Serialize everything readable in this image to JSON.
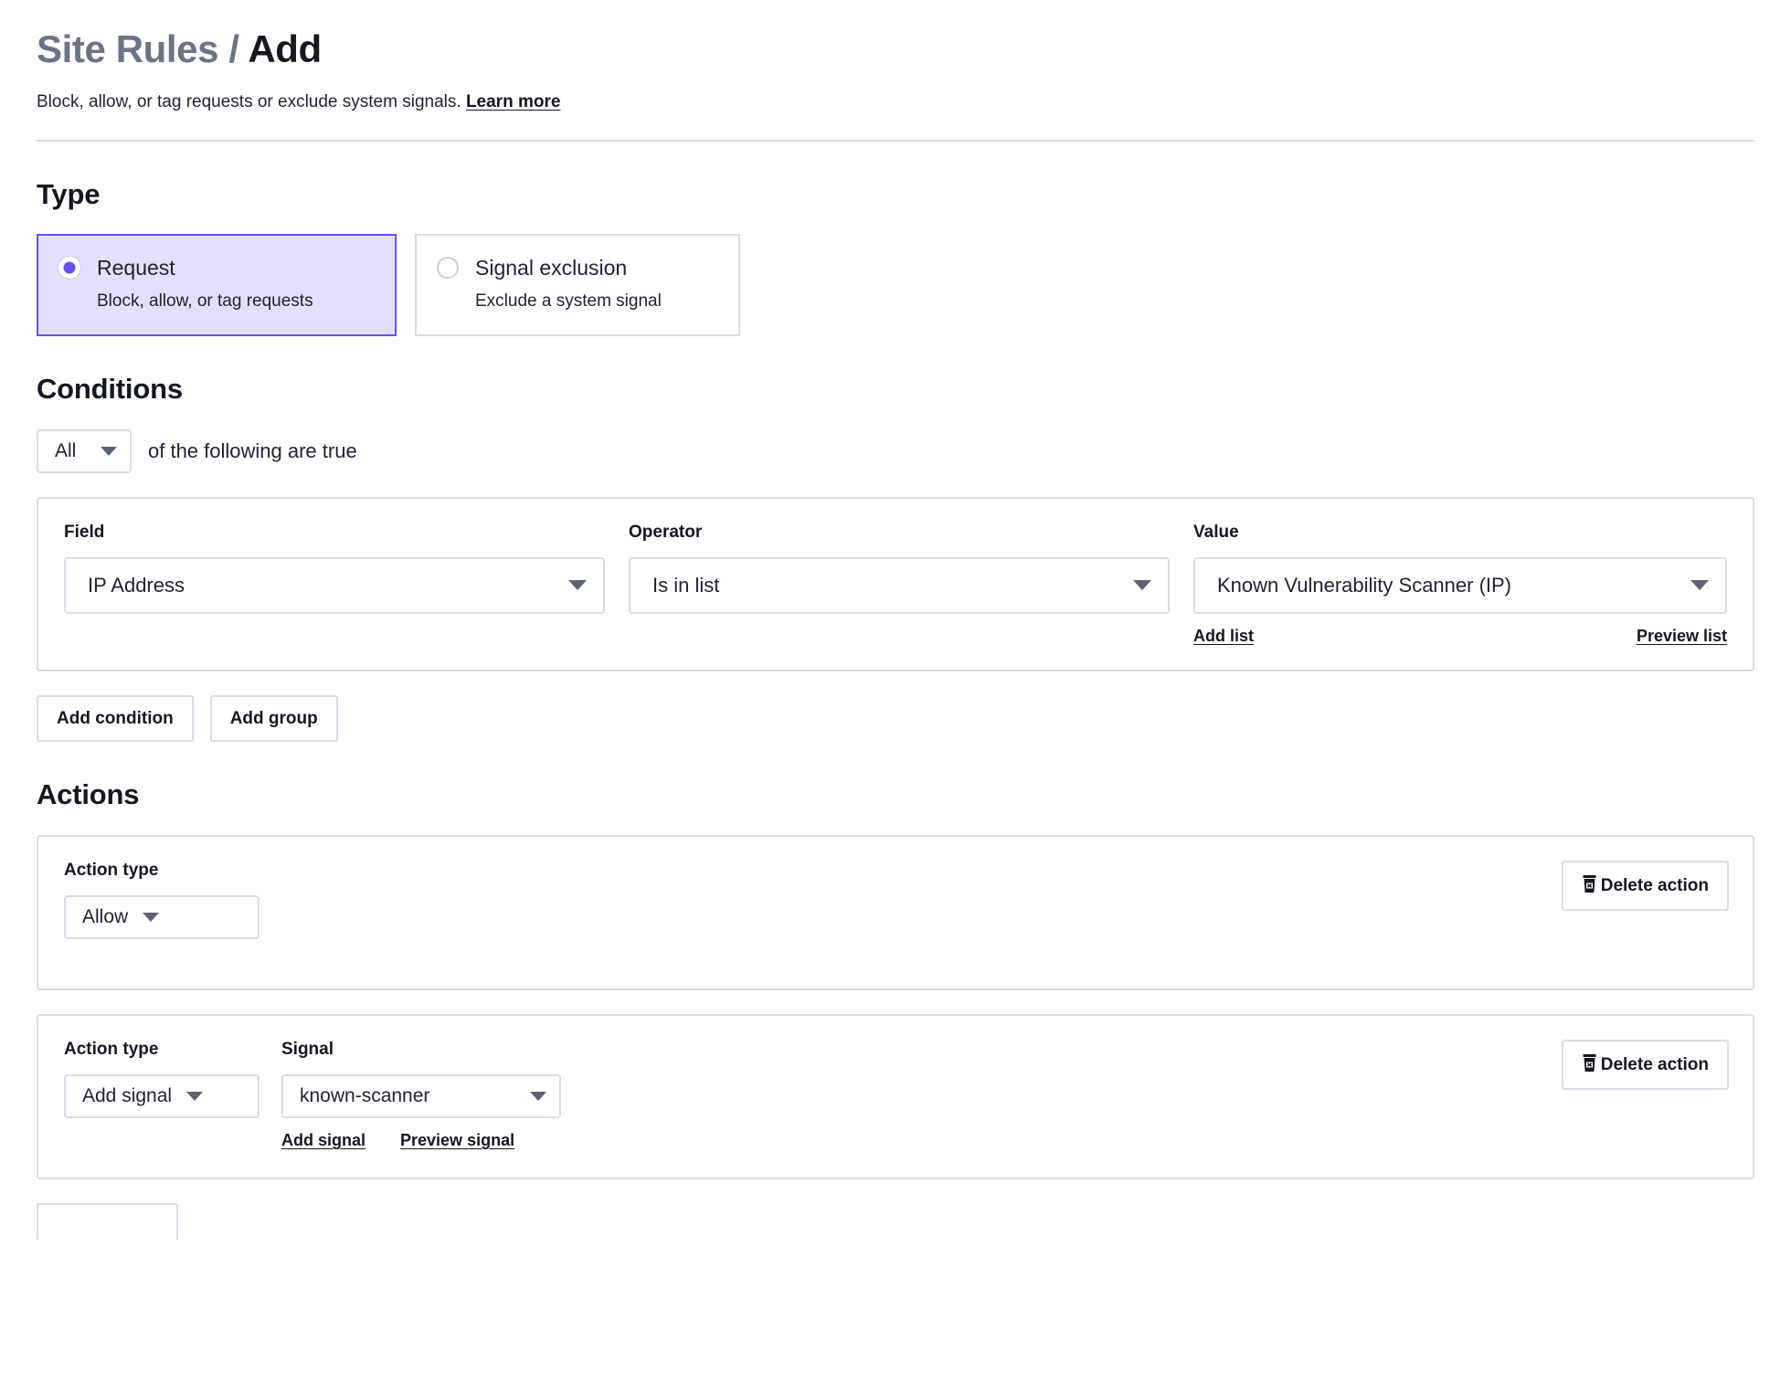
{
  "header": {
    "breadcrumb_parent": "Site Rules",
    "breadcrumb_separator": "/",
    "breadcrumb_current": "Add",
    "subtitle": "Block, allow, or tag requests or exclude system signals.",
    "learn_more": "Learn more"
  },
  "type": {
    "heading": "Type",
    "options": [
      {
        "label": "Request",
        "description": "Block, allow, or tag requests",
        "selected": true
      },
      {
        "label": "Signal exclusion",
        "description": "Exclude a system signal",
        "selected": false
      }
    ]
  },
  "conditions": {
    "heading": "Conditions",
    "match_select": "All",
    "match_suffix": "of the following are true",
    "rows": [
      {
        "field_label": "Field",
        "field_value": "IP Address",
        "operator_label": "Operator",
        "operator_value": "Is in list",
        "value_label": "Value",
        "value_value": "Known Vulnerability Scanner (IP)",
        "add_list_link": "Add list",
        "preview_list_link": "Preview list"
      }
    ],
    "add_condition_button": "Add condition",
    "add_group_button": "Add group"
  },
  "actions": {
    "heading": "Actions",
    "items": [
      {
        "action_type_label": "Action type",
        "action_type_value": "Allow",
        "delete_button": "Delete action",
        "delete_icon": "trash-icon",
        "has_signal": false
      },
      {
        "action_type_label": "Action type",
        "action_type_value": "Add signal",
        "signal_label": "Signal",
        "signal_value": "known-scanner",
        "add_signal_link": "Add signal",
        "preview_signal_link": "Preview signal",
        "delete_button": "Delete action",
        "delete_icon": "trash-icon",
        "has_signal": true
      }
    ]
  },
  "colors": {
    "accent_purple": "#6b4ef5",
    "selected_card_bg": "#e3dffc",
    "border_gray": "#d8dce4",
    "text_dark": "#14181f",
    "muted_title": "#6b7387"
  }
}
